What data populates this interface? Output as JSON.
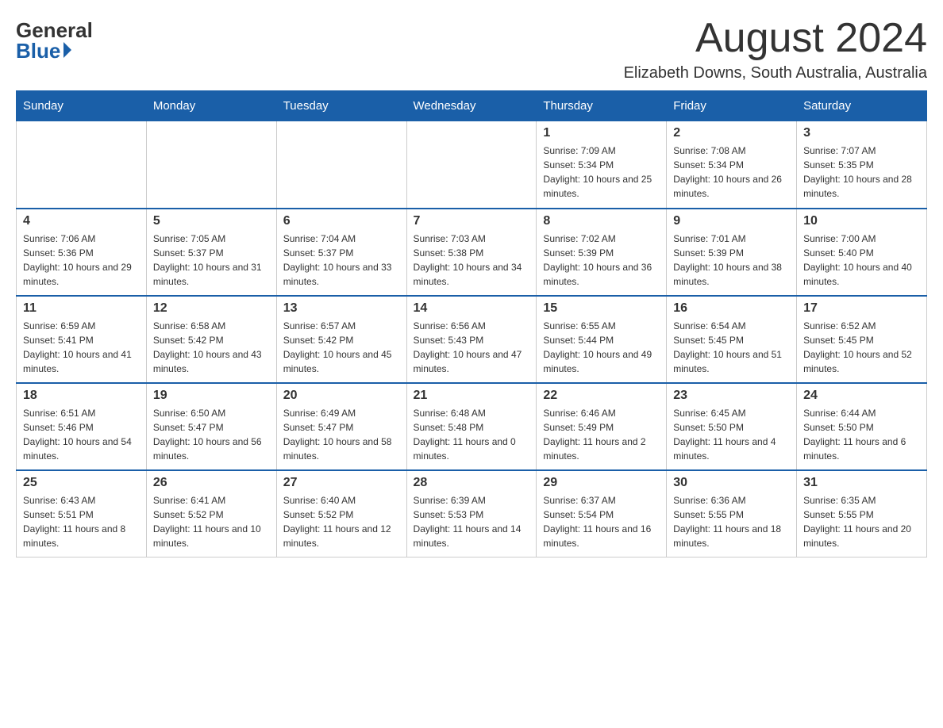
{
  "header": {
    "logo_general": "General",
    "logo_blue": "Blue",
    "month_title": "August 2024",
    "location": "Elizabeth Downs, South Australia, Australia"
  },
  "days_of_week": [
    "Sunday",
    "Monday",
    "Tuesday",
    "Wednesday",
    "Thursday",
    "Friday",
    "Saturday"
  ],
  "weeks": [
    [
      {
        "day": "",
        "info": ""
      },
      {
        "day": "",
        "info": ""
      },
      {
        "day": "",
        "info": ""
      },
      {
        "day": "",
        "info": ""
      },
      {
        "day": "1",
        "info": "Sunrise: 7:09 AM\nSunset: 5:34 PM\nDaylight: 10 hours and 25 minutes."
      },
      {
        "day": "2",
        "info": "Sunrise: 7:08 AM\nSunset: 5:34 PM\nDaylight: 10 hours and 26 minutes."
      },
      {
        "day": "3",
        "info": "Sunrise: 7:07 AM\nSunset: 5:35 PM\nDaylight: 10 hours and 28 minutes."
      }
    ],
    [
      {
        "day": "4",
        "info": "Sunrise: 7:06 AM\nSunset: 5:36 PM\nDaylight: 10 hours and 29 minutes."
      },
      {
        "day": "5",
        "info": "Sunrise: 7:05 AM\nSunset: 5:37 PM\nDaylight: 10 hours and 31 minutes."
      },
      {
        "day": "6",
        "info": "Sunrise: 7:04 AM\nSunset: 5:37 PM\nDaylight: 10 hours and 33 minutes."
      },
      {
        "day": "7",
        "info": "Sunrise: 7:03 AM\nSunset: 5:38 PM\nDaylight: 10 hours and 34 minutes."
      },
      {
        "day": "8",
        "info": "Sunrise: 7:02 AM\nSunset: 5:39 PM\nDaylight: 10 hours and 36 minutes."
      },
      {
        "day": "9",
        "info": "Sunrise: 7:01 AM\nSunset: 5:39 PM\nDaylight: 10 hours and 38 minutes."
      },
      {
        "day": "10",
        "info": "Sunrise: 7:00 AM\nSunset: 5:40 PM\nDaylight: 10 hours and 40 minutes."
      }
    ],
    [
      {
        "day": "11",
        "info": "Sunrise: 6:59 AM\nSunset: 5:41 PM\nDaylight: 10 hours and 41 minutes."
      },
      {
        "day": "12",
        "info": "Sunrise: 6:58 AM\nSunset: 5:42 PM\nDaylight: 10 hours and 43 minutes."
      },
      {
        "day": "13",
        "info": "Sunrise: 6:57 AM\nSunset: 5:42 PM\nDaylight: 10 hours and 45 minutes."
      },
      {
        "day": "14",
        "info": "Sunrise: 6:56 AM\nSunset: 5:43 PM\nDaylight: 10 hours and 47 minutes."
      },
      {
        "day": "15",
        "info": "Sunrise: 6:55 AM\nSunset: 5:44 PM\nDaylight: 10 hours and 49 minutes."
      },
      {
        "day": "16",
        "info": "Sunrise: 6:54 AM\nSunset: 5:45 PM\nDaylight: 10 hours and 51 minutes."
      },
      {
        "day": "17",
        "info": "Sunrise: 6:52 AM\nSunset: 5:45 PM\nDaylight: 10 hours and 52 minutes."
      }
    ],
    [
      {
        "day": "18",
        "info": "Sunrise: 6:51 AM\nSunset: 5:46 PM\nDaylight: 10 hours and 54 minutes."
      },
      {
        "day": "19",
        "info": "Sunrise: 6:50 AM\nSunset: 5:47 PM\nDaylight: 10 hours and 56 minutes."
      },
      {
        "day": "20",
        "info": "Sunrise: 6:49 AM\nSunset: 5:47 PM\nDaylight: 10 hours and 58 minutes."
      },
      {
        "day": "21",
        "info": "Sunrise: 6:48 AM\nSunset: 5:48 PM\nDaylight: 11 hours and 0 minutes."
      },
      {
        "day": "22",
        "info": "Sunrise: 6:46 AM\nSunset: 5:49 PM\nDaylight: 11 hours and 2 minutes."
      },
      {
        "day": "23",
        "info": "Sunrise: 6:45 AM\nSunset: 5:50 PM\nDaylight: 11 hours and 4 minutes."
      },
      {
        "day": "24",
        "info": "Sunrise: 6:44 AM\nSunset: 5:50 PM\nDaylight: 11 hours and 6 minutes."
      }
    ],
    [
      {
        "day": "25",
        "info": "Sunrise: 6:43 AM\nSunset: 5:51 PM\nDaylight: 11 hours and 8 minutes."
      },
      {
        "day": "26",
        "info": "Sunrise: 6:41 AM\nSunset: 5:52 PM\nDaylight: 11 hours and 10 minutes."
      },
      {
        "day": "27",
        "info": "Sunrise: 6:40 AM\nSunset: 5:52 PM\nDaylight: 11 hours and 12 minutes."
      },
      {
        "day": "28",
        "info": "Sunrise: 6:39 AM\nSunset: 5:53 PM\nDaylight: 11 hours and 14 minutes."
      },
      {
        "day": "29",
        "info": "Sunrise: 6:37 AM\nSunset: 5:54 PM\nDaylight: 11 hours and 16 minutes."
      },
      {
        "day": "30",
        "info": "Sunrise: 6:36 AM\nSunset: 5:55 PM\nDaylight: 11 hours and 18 minutes."
      },
      {
        "day": "31",
        "info": "Sunrise: 6:35 AM\nSunset: 5:55 PM\nDaylight: 11 hours and 20 minutes."
      }
    ]
  ]
}
